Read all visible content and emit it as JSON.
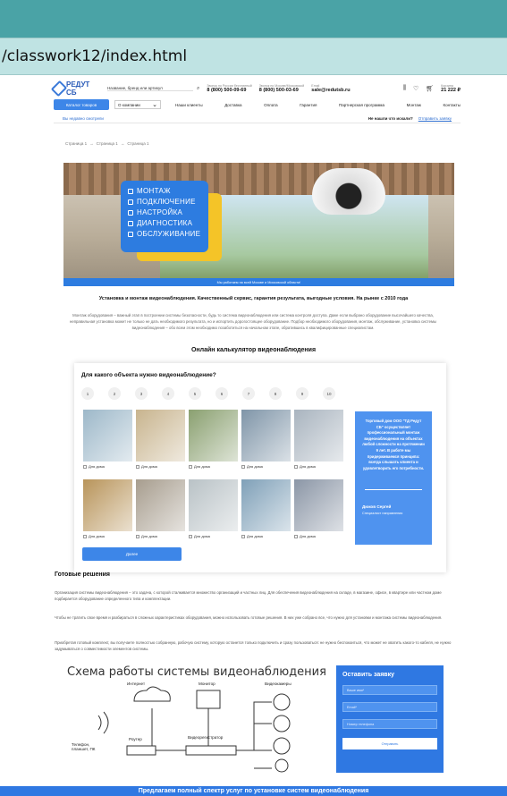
{
  "browser": {
    "url": "/classwork12/index.html"
  },
  "header": {
    "logo_text": "РЕДУТ СБ",
    "search_placeholder": "Название, бренд или артикул",
    "phone1_label": "Звонок по России бесплатный",
    "phone1": "8 (800) 500-09-69",
    "phone2_label": "Звонок по Москве/Московской",
    "phone2": "8 (800) 500-03-69",
    "email_label": "Email",
    "email": "sale@redutsb.ru",
    "cart_label": "Корзина",
    "cart_sum": "21 222 ₽"
  },
  "nav": {
    "catalog_button": "Каталог товаров",
    "about_dropdown": "О компании",
    "items": [
      "Наши клиенты",
      "Доставка",
      "Оплата",
      "Гарантия",
      "Партнерская программа",
      "Монтаж",
      "Контакты"
    ]
  },
  "subbar": {
    "link": "Вы недавно смотрели",
    "question": "Не нашли что искали?",
    "help": "Отправить заявку"
  },
  "breadcrumbs": [
    "Страница 1",
    "→",
    "Страница 1",
    "→",
    "Страница 1"
  ],
  "hero": {
    "services": [
      "МОНТАЖ",
      "ПОДКЛЮЧЕНИЕ",
      "НАСТРОЙКА",
      "ДИАГНОСТИКА",
      "ОБСЛУЖИВАНИЕ"
    ],
    "strip": "Мы работаем на всей Москве и Московской области!"
  },
  "intro": {
    "title": "Установка и монтаж видеонаблюдения. Качественный сервис, гарантия результата, выгодные условия. На рынке с 2010 года",
    "text": "Монтаж оборудования – важный этап в построении системы безопасности, будь то система видеонаблюдения или система контроля доступа. Даже если выбрано оборудование высочайшего качества, неправильная установка может не только не дать необходимого результата, но и испортить дорогостоящее оборудование. Подбор необходимого оборудования, монтаж, обслуживание, установка системы видеонаблюдения – обо всем этом необходимо позаботиться на начальном этапе, обратившись в квалифицированные специалистам."
  },
  "calculator": {
    "section_title": "Онлайн калькулятор видеонаблюдения",
    "question": "Для какого объекта нужно видеонаблюдение?",
    "steps": [
      "1",
      "2",
      "3",
      "4",
      "5",
      "6",
      "7",
      "8",
      "9",
      "10"
    ],
    "tiles": [
      {
        "label": "Для дома",
        "color": "#9db8c9"
      },
      {
        "label": "Для дома",
        "color": "#c8b48e"
      },
      {
        "label": "Для дома",
        "color": "#8aa070"
      },
      {
        "label": "Для дома",
        "color": "#7f95a8"
      },
      {
        "label": "Для дома",
        "color": "#a9b4bf"
      },
      {
        "label": "Для дома",
        "color": "#b8945a"
      },
      {
        "label": "Для дома",
        "color": "#a79d8e"
      },
      {
        "label": "Для дома",
        "color": "#b9c2c6"
      },
      {
        "label": "Для дома",
        "color": "#7fa0b8"
      },
      {
        "label": "Для дома",
        "color": "#8b96a6"
      }
    ],
    "info_text": "Торговый дом ООО \"ТД Редут СБ\" осуществляет профессиональный монтаж видеонаблюдения на объектах любой сложности на протяжении 9 лет. В работе мы придерживаемся принципа: всегда слышать клиента и удовлетворить его потребности.",
    "manager_name": "Дюков Сергей",
    "manager_role": "Специалист направления",
    "next_button": "Далее"
  },
  "ready": {
    "title": "Готовые решения",
    "p1": "Организация системы видеонаблюдения – это задача, с которой сталкивается множество организаций и частных лиц. Для обеспечения видеонаблюдения на складе, в магазине, офисе, в квартире или частном доме подбирается оборудование определенного типа и комплектации.",
    "p2": "Чтобы не тратить свое время и разбираться в сложных характеристиках оборудования, можно использовать готовые решения. В них уже собрано все, что нужно для установки и монтажа системы видеонаблюдения.",
    "p3": "Приобретая готовый комплект, вы получаете полностью собранную, рабочую систему, которую останется только подключить и сразу пользоваться: не нужно беспокоиться, что может не хватить какого-то кабеля, не нужно задумываться о совместимости элементов системы."
  },
  "scheme": {
    "title": "Схема работы системы видеонаблюдения",
    "labels": {
      "internet": "Интернет",
      "monitor": "Монитор",
      "cameras": "Видеокамеры",
      "phone": "Телефон, планшет, ПК",
      "router": "Роутер",
      "recorder": "Видеорегистратор"
    }
  },
  "form": {
    "title": "Оставить заявку",
    "name": "Ваше имя*",
    "email": "Email*",
    "phone": "Номер телефона",
    "send": "Отправить"
  },
  "bottom": {
    "banner": "Предлагаем полный спектр услуг по установке систем видеонаблюдения"
  },
  "colors": {
    "accent": "#2f78e2",
    "chrome": "#4aa3a6",
    "address_bar": "#bfe3e3"
  }
}
